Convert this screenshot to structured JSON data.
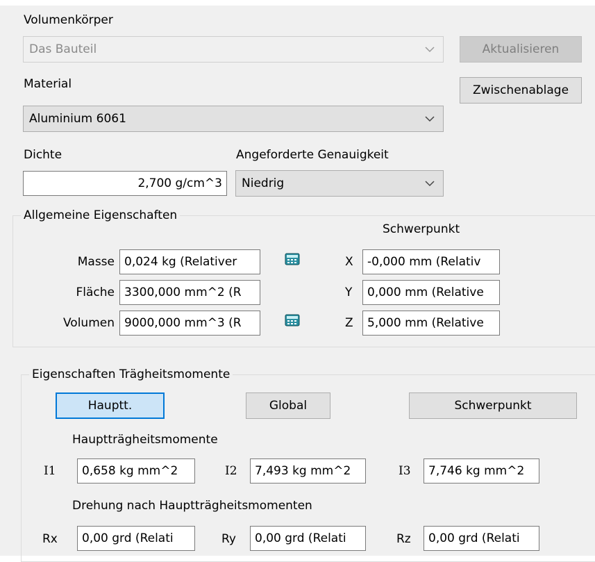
{
  "solid": {
    "label": "Volumenkörper",
    "value": "Das Bauteil"
  },
  "update_button": "Aktualisieren",
  "clipboard_button": "Zwischenablage",
  "material": {
    "label": "Material",
    "value": "Aluminium 6061"
  },
  "density": {
    "label": "Dichte",
    "value": "2,700 g/cm^3"
  },
  "accuracy": {
    "label": "Angeforderte Genauigkeit",
    "value": "Niedrig"
  },
  "general": {
    "title": "Allgemeine Eigenschaften",
    "center_of_gravity_label": "Schwerpunkt",
    "mass": {
      "label": "Masse",
      "value": "0,024 kg (Relativer"
    },
    "area": {
      "label": "Fläche",
      "value": "3300,000 mm^2 (R"
    },
    "volume": {
      "label": "Volumen",
      "value": "9000,000 mm^3 (R"
    },
    "x": {
      "label": "X",
      "value": "-0,000 mm (Relativ"
    },
    "y": {
      "label": "Y",
      "value": "0,000 mm (Relative"
    },
    "z": {
      "label": "Z",
      "value": "5,000 mm (Relative"
    }
  },
  "inertia": {
    "title": "Eigenschaften Trägheitsmomente",
    "buttons": {
      "principal": "Hauptt.",
      "global": "Global",
      "center": "Schwerpunkt"
    },
    "principal_moments_label": "Hauptträgheitsmomente",
    "i1": {
      "label": "I1",
      "value": "0,658 kg mm^2"
    },
    "i2": {
      "label": "I2",
      "value": "7,493 kg mm^2"
    },
    "i3": {
      "label": "I3",
      "value": "7,746 kg mm^2"
    },
    "rotation_label": "Drehung nach Hauptträgheitsmomenten",
    "rx": {
      "label": "Rx",
      "value": "0,00 grd (Relati"
    },
    "ry": {
      "label": "Ry",
      "value": "0,00 grd (Relati"
    },
    "rz": {
      "label": "Rz",
      "value": "0,00 grd (Relati"
    }
  },
  "colors": {
    "dialog_bg": "#f0f0f0",
    "button_bg": "#e1e1e1",
    "active_button_bg": "#cce4f7",
    "active_button_border": "#0078d7",
    "calculator_icon": "#2a8fa0"
  }
}
